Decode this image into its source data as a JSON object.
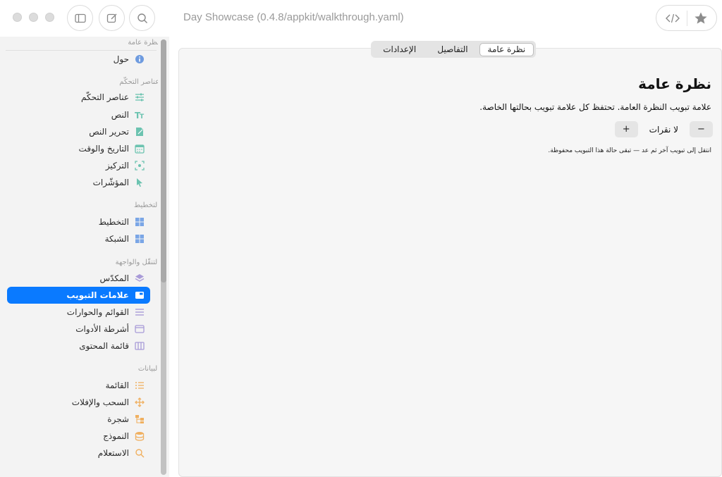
{
  "window": {
    "title": "Day Showcase (0.4.8/appkit/walkthrough.yaml)"
  },
  "toolbar": {
    "sidebar_toggle_icon": "sidebar-icon",
    "compose_icon": "compose-icon",
    "search_icon": "search-icon",
    "code_icon": "code-icon",
    "star_icon": "star-icon"
  },
  "sidebar": {
    "sections": [
      {
        "title": "نظرة عامة",
        "items": [
          {
            "label": "حول",
            "icon": "info-icon",
            "color": "#6e9bdf"
          }
        ]
      },
      {
        "title": "عناصر التحكّم",
        "items": [
          {
            "label": "عناصر التحكّم",
            "icon": "sliders-icon",
            "color": "#6cc3b0"
          },
          {
            "label": "النص",
            "icon": "text-icon",
            "color": "#6cc3b0"
          },
          {
            "label": "تحرير النص",
            "icon": "edit-doc-icon",
            "color": "#6cc3b0"
          },
          {
            "label": "التاريخ والوقت",
            "icon": "calendar-icon",
            "color": "#6cc3b0"
          },
          {
            "label": "التركيز",
            "icon": "focus-icon",
            "color": "#6cc3b0"
          },
          {
            "label": "المؤشّرات",
            "icon": "cursor-icon",
            "color": "#6cc3b0"
          }
        ]
      },
      {
        "title": "التخطيط",
        "items": [
          {
            "label": "التخطيط",
            "icon": "layout-icon",
            "color": "#7aa6e6"
          },
          {
            "label": "الشبكة",
            "icon": "grid-icon",
            "color": "#7aa6e6"
          }
        ]
      },
      {
        "title": "التنقّل والواجهة",
        "items": [
          {
            "label": "المكدّس",
            "icon": "stack-icon",
            "color": "#a99bd8"
          },
          {
            "label": "علامات التبويب",
            "icon": "tabs-icon",
            "color": "#ffffff",
            "active": true
          },
          {
            "label": "القوائم والحوارات",
            "icon": "menu-icon",
            "color": "#a99bd8"
          },
          {
            "label": "أشرطة الأدوات",
            "icon": "toolbar-icon",
            "color": "#a99bd8"
          },
          {
            "label": "قائمة المحتوى",
            "icon": "columns-icon",
            "color": "#a99bd8"
          }
        ]
      },
      {
        "title": "البيانات",
        "items": [
          {
            "label": "القائمة",
            "icon": "list-icon",
            "color": "#f0b060"
          },
          {
            "label": "السحب والإفلات",
            "icon": "move-icon",
            "color": "#f0b060"
          },
          {
            "label": "شجرة",
            "icon": "tree-icon",
            "color": "#f0b060"
          },
          {
            "label": "النموذج",
            "icon": "database-icon",
            "color": "#f0b060"
          },
          {
            "label": "الاستعلام",
            "icon": "query-icon",
            "color": "#f0b060"
          }
        ]
      }
    ],
    "accent": "#0a7aff"
  },
  "content": {
    "tabs": [
      {
        "label": "نظرة عامة",
        "selected": true
      },
      {
        "label": "التفاصيل",
        "selected": false
      },
      {
        "label": "الإعدادات",
        "selected": false
      }
    ],
    "title": "نظرة عامة",
    "description": "علامة تبويب النظرة العامة. تحتفظ كل علامة تبويب بحالتها الخاصة.",
    "counter_label": "لا نقرات",
    "minus_label": "−",
    "plus_label": "+",
    "hint": "انتقل إلى تبويب آخر ثم عد — تبقى حالة هذا التبويب محفوظة."
  }
}
